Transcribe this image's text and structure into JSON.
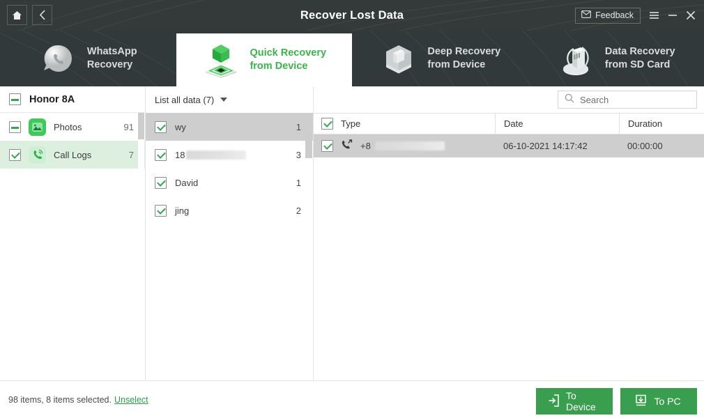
{
  "window": {
    "title": "Recover Lost Data",
    "home_icon": "home-icon",
    "back_icon": "back-chevron-icon",
    "feedback_label": "Feedback",
    "feedback_icon": "envelope-icon",
    "menu_icon": "hamburger-menu-icon",
    "minimize_icon": "minimize-icon",
    "close_icon": "close-icon",
    "bg_color": "#343a3a"
  },
  "tabs": [
    {
      "label": "WhatsApp\nRecovery",
      "icon": "whatsapp-balloon-icon",
      "active": false
    },
    {
      "label": "Quick Recovery\nfrom Device",
      "icon": "green-cube-platform-icon",
      "active": true
    },
    {
      "label": "Deep Recovery\nfrom Device",
      "icon": "glass-box-icon",
      "active": false
    },
    {
      "label": "Data Recovery\nfrom SD Card",
      "icon": "sd-card-icon",
      "active": false
    }
  ],
  "sidebar": {
    "device": {
      "name": "Honor 8A",
      "checkbox": "indeterminate"
    },
    "items": [
      {
        "label": "Photos",
        "count": "91",
        "checkbox": "indeterminate",
        "icon": "photos-icon",
        "selected": false
      },
      {
        "label": "Call Logs",
        "count": "7",
        "checkbox": "checked",
        "icon": "call-logs-icon",
        "selected": true
      }
    ]
  },
  "middle": {
    "filter_label": "List all data (7)",
    "dropdown_icon": "caret-down-icon",
    "rows": [
      {
        "name": "wy",
        "redacted": false,
        "count": "1",
        "checkbox": "checked",
        "selected": true
      },
      {
        "name": "18",
        "redacted": true,
        "count": "3",
        "checkbox": "checked",
        "selected": false
      },
      {
        "name": "David",
        "redacted": false,
        "count": "1",
        "checkbox": "checked",
        "selected": false
      },
      {
        "name": "jing",
        "redacted": false,
        "count": "2",
        "checkbox": "checked",
        "selected": false
      }
    ]
  },
  "right": {
    "search": {
      "placeholder": "Search",
      "value": "",
      "icon": "search-icon"
    },
    "columns": [
      "Type",
      "Date",
      "Duration"
    ],
    "header_checkbox": "checked",
    "rows": [
      {
        "type": "+8",
        "redacted": true,
        "date": "06-10-2021 14:17:42",
        "duration": "00:00:00",
        "checkbox": "checked",
        "call_icon": "outgoing-call-icon",
        "selected": true
      }
    ]
  },
  "bottom": {
    "status": "98 items, 8 items selected.",
    "unselect_label": "Unselect",
    "to_device_label": "To Device",
    "to_device_icon": "export-to-device-icon",
    "to_pc_label": "To PC",
    "to_pc_icon": "download-to-pc-icon",
    "accent_color": "#3a9e4f"
  }
}
